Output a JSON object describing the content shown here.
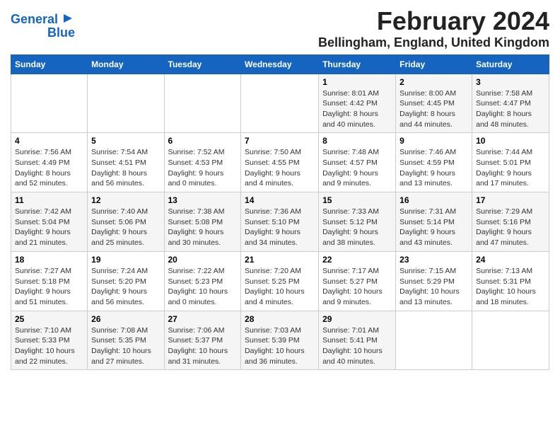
{
  "logo": {
    "line1": "General",
    "line2": "Blue"
  },
  "title": "February 2024",
  "subtitle": "Bellingham, England, United Kingdom",
  "days_of_week": [
    "Sunday",
    "Monday",
    "Tuesday",
    "Wednesday",
    "Thursday",
    "Friday",
    "Saturday"
  ],
  "weeks": [
    [
      {
        "num": "",
        "info": ""
      },
      {
        "num": "",
        "info": ""
      },
      {
        "num": "",
        "info": ""
      },
      {
        "num": "",
        "info": ""
      },
      {
        "num": "1",
        "info": "Sunrise: 8:01 AM\nSunset: 4:42 PM\nDaylight: 8 hours\nand 40 minutes."
      },
      {
        "num": "2",
        "info": "Sunrise: 8:00 AM\nSunset: 4:45 PM\nDaylight: 8 hours\nand 44 minutes."
      },
      {
        "num": "3",
        "info": "Sunrise: 7:58 AM\nSunset: 4:47 PM\nDaylight: 8 hours\nand 48 minutes."
      }
    ],
    [
      {
        "num": "4",
        "info": "Sunrise: 7:56 AM\nSunset: 4:49 PM\nDaylight: 8 hours\nand 52 minutes."
      },
      {
        "num": "5",
        "info": "Sunrise: 7:54 AM\nSunset: 4:51 PM\nDaylight: 8 hours\nand 56 minutes."
      },
      {
        "num": "6",
        "info": "Sunrise: 7:52 AM\nSunset: 4:53 PM\nDaylight: 9 hours\nand 0 minutes."
      },
      {
        "num": "7",
        "info": "Sunrise: 7:50 AM\nSunset: 4:55 PM\nDaylight: 9 hours\nand 4 minutes."
      },
      {
        "num": "8",
        "info": "Sunrise: 7:48 AM\nSunset: 4:57 PM\nDaylight: 9 hours\nand 9 minutes."
      },
      {
        "num": "9",
        "info": "Sunrise: 7:46 AM\nSunset: 4:59 PM\nDaylight: 9 hours\nand 13 minutes."
      },
      {
        "num": "10",
        "info": "Sunrise: 7:44 AM\nSunset: 5:01 PM\nDaylight: 9 hours\nand 17 minutes."
      }
    ],
    [
      {
        "num": "11",
        "info": "Sunrise: 7:42 AM\nSunset: 5:04 PM\nDaylight: 9 hours\nand 21 minutes."
      },
      {
        "num": "12",
        "info": "Sunrise: 7:40 AM\nSunset: 5:06 PM\nDaylight: 9 hours\nand 25 minutes."
      },
      {
        "num": "13",
        "info": "Sunrise: 7:38 AM\nSunset: 5:08 PM\nDaylight: 9 hours\nand 30 minutes."
      },
      {
        "num": "14",
        "info": "Sunrise: 7:36 AM\nSunset: 5:10 PM\nDaylight: 9 hours\nand 34 minutes."
      },
      {
        "num": "15",
        "info": "Sunrise: 7:33 AM\nSunset: 5:12 PM\nDaylight: 9 hours\nand 38 minutes."
      },
      {
        "num": "16",
        "info": "Sunrise: 7:31 AM\nSunset: 5:14 PM\nDaylight: 9 hours\nand 43 minutes."
      },
      {
        "num": "17",
        "info": "Sunrise: 7:29 AM\nSunset: 5:16 PM\nDaylight: 9 hours\nand 47 minutes."
      }
    ],
    [
      {
        "num": "18",
        "info": "Sunrise: 7:27 AM\nSunset: 5:18 PM\nDaylight: 9 hours\nand 51 minutes."
      },
      {
        "num": "19",
        "info": "Sunrise: 7:24 AM\nSunset: 5:20 PM\nDaylight: 9 hours\nand 56 minutes."
      },
      {
        "num": "20",
        "info": "Sunrise: 7:22 AM\nSunset: 5:23 PM\nDaylight: 10 hours\nand 0 minutes."
      },
      {
        "num": "21",
        "info": "Sunrise: 7:20 AM\nSunset: 5:25 PM\nDaylight: 10 hours\nand 4 minutes."
      },
      {
        "num": "22",
        "info": "Sunrise: 7:17 AM\nSunset: 5:27 PM\nDaylight: 10 hours\nand 9 minutes."
      },
      {
        "num": "23",
        "info": "Sunrise: 7:15 AM\nSunset: 5:29 PM\nDaylight: 10 hours\nand 13 minutes."
      },
      {
        "num": "24",
        "info": "Sunrise: 7:13 AM\nSunset: 5:31 PM\nDaylight: 10 hours\nand 18 minutes."
      }
    ],
    [
      {
        "num": "25",
        "info": "Sunrise: 7:10 AM\nSunset: 5:33 PM\nDaylight: 10 hours\nand 22 minutes."
      },
      {
        "num": "26",
        "info": "Sunrise: 7:08 AM\nSunset: 5:35 PM\nDaylight: 10 hours\nand 27 minutes."
      },
      {
        "num": "27",
        "info": "Sunrise: 7:06 AM\nSunset: 5:37 PM\nDaylight: 10 hours\nand 31 minutes."
      },
      {
        "num": "28",
        "info": "Sunrise: 7:03 AM\nSunset: 5:39 PM\nDaylight: 10 hours\nand 36 minutes."
      },
      {
        "num": "29",
        "info": "Sunrise: 7:01 AM\nSunset: 5:41 PM\nDaylight: 10 hours\nand 40 minutes."
      },
      {
        "num": "",
        "info": ""
      },
      {
        "num": "",
        "info": ""
      }
    ]
  ]
}
